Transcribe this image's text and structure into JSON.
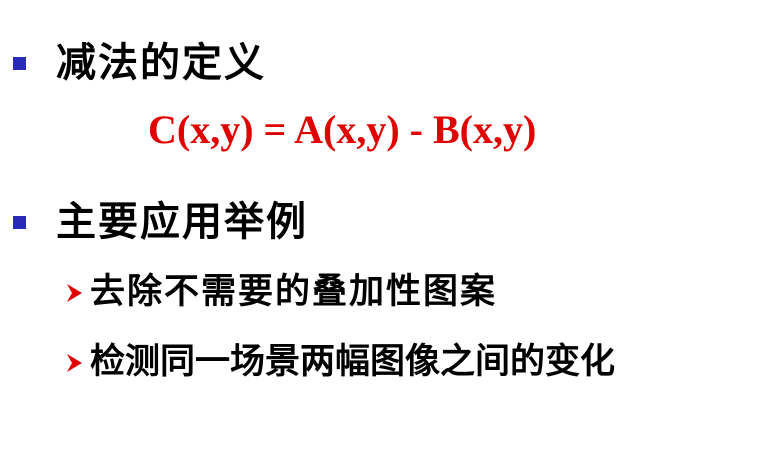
{
  "colors": {
    "bullet_square": "#2a2ab8",
    "bullet_arrow": "#e00000",
    "formula": "#e00000",
    "text": "#000000"
  },
  "section1": {
    "heading": "减法的定义",
    "formula": "C(x,y) = A(x,y) - B(x,y)"
  },
  "section2": {
    "heading": "主要应用举例",
    "items": [
      "去除不需要的叠加性图案",
      "检测同一场景两幅图像之间的变化"
    ]
  }
}
